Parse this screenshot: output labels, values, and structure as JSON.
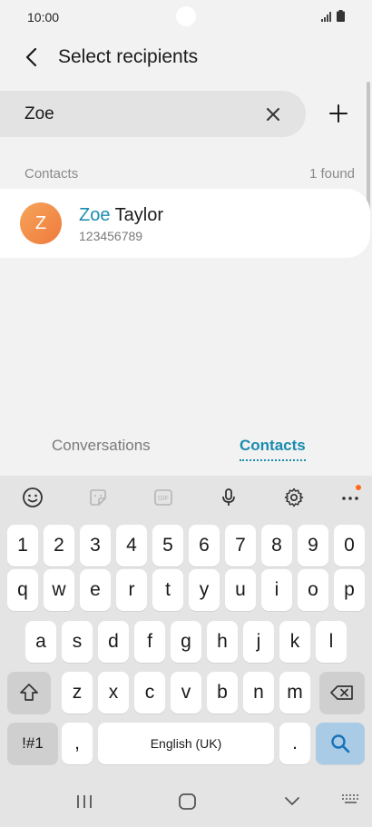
{
  "status_bar": {
    "time": "10:00"
  },
  "header": {
    "title": "Select recipients"
  },
  "search": {
    "value": "Zoe",
    "placeholder": ""
  },
  "section": {
    "label": "Contacts",
    "count": "1 found"
  },
  "contact": {
    "initial": "Z",
    "highlight": "Zoe",
    "rest": " Taylor",
    "number": "123456789"
  },
  "tabs": [
    {
      "label": "Conversations"
    },
    {
      "label": "Contacts"
    }
  ],
  "keyboard": {
    "row_numbers": [
      "1",
      "2",
      "3",
      "4",
      "5",
      "6",
      "7",
      "8",
      "9",
      "0"
    ],
    "row_top": [
      "q",
      "w",
      "e",
      "r",
      "t",
      "y",
      "u",
      "i",
      "o",
      "p"
    ],
    "row_mid": [
      "a",
      "s",
      "d",
      "f",
      "g",
      "h",
      "j",
      "k",
      "l"
    ],
    "row_bottom": [
      "z",
      "x",
      "c",
      "v",
      "b",
      "n",
      "m"
    ],
    "symbols_label": "!#1",
    "comma_label": ",",
    "space_label": "English (UK)",
    "period_label": "."
  },
  "colors": {
    "accent": "#1b8bb0",
    "avatar": "#f08a45",
    "notification_dot": "#ff6a1f"
  },
  "icons": [
    "back-arrow-icon",
    "clear-icon",
    "add-icon",
    "emoji-icon",
    "sticker-icon",
    "gif-icon",
    "microphone-icon",
    "gear-icon",
    "more-icon",
    "shift-icon",
    "backspace-icon",
    "search-icon",
    "recent-apps-icon",
    "home-icon",
    "back-nav-icon",
    "keyboard-icon"
  ]
}
